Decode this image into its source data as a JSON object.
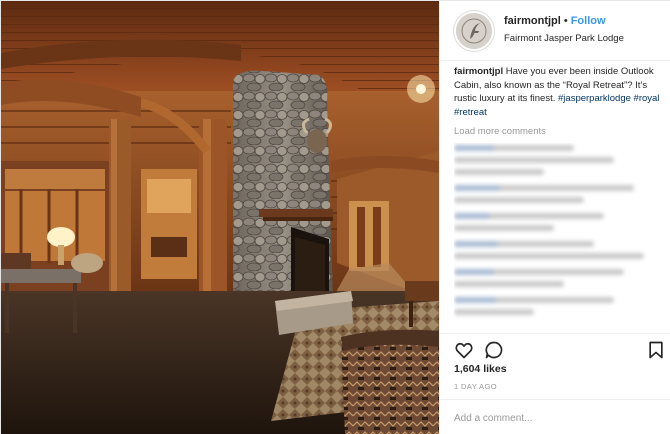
{
  "photo": {
    "subject": "lodge-interior-photo"
  },
  "header": {
    "username": "fairmontjpl",
    "separator": "•",
    "follow_label": "Follow",
    "location": "Fairmont Jasper Park Lodge"
  },
  "caption": {
    "username": "fairmontjpl",
    "text": "Have you ever been inside Outlook Cabin, also known as the “Royal Retreat”? It’s rustic luxury at its finest.",
    "hashtags": [
      "#jasperparklodge",
      "#royal",
      "#retreat"
    ]
  },
  "comments": {
    "load_more_label": "Load more comments"
  },
  "actions": {
    "like_icon": "heart-icon",
    "comment_icon": "speech-bubble-icon",
    "save_icon": "bookmark-icon"
  },
  "stats": {
    "likes": "1,604 likes",
    "posted": "1 DAY AGO"
  },
  "comment_box": {
    "placeholder": "Add a comment..."
  },
  "colors": {
    "accent": "#3897f0",
    "hashtag": "#003569",
    "wood": "#8a4a22",
    "muted": "#999999"
  }
}
